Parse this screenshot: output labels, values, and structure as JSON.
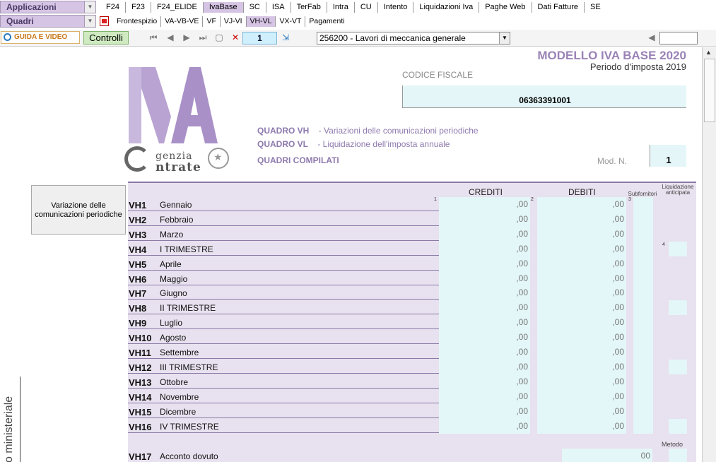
{
  "menu1": {
    "selector": "Applicazioni",
    "tabs": [
      "F24",
      "F23",
      "F24_ELIDE",
      "IvaBase",
      "SC",
      "ISA",
      "TerFab",
      "Intra",
      "CU",
      "Intento",
      "Liquidazioni Iva",
      "Paghe Web",
      "Dati Fatture",
      "SE"
    ],
    "active": 3
  },
  "menu2": {
    "selector": "Quadri",
    "tabs": [
      "Frontespizio",
      "VA-VB-VE",
      "VF",
      "VJ-VI",
      "VH-VL",
      "VX-VT",
      "Pagamenti"
    ],
    "active": 4
  },
  "toolbar": {
    "guide_label": "GUIDA E VIDEO",
    "controlli_label": "Controlli",
    "page_number": "1",
    "company": "256200 - Lavori di meccanica generale"
  },
  "doc": {
    "title": "MODELLO IVA BASE 2020",
    "subtitle": "Periodo d'imposta 2019",
    "cf_label": "CODICE FISCALE",
    "cf_value": "06363391001",
    "logo_letters": "IVA",
    "agency": "genzia\nntrate",
    "quadro1_key": "QUADRO VH",
    "quadro1_desc": "- Variazioni delle comunicazioni periodiche",
    "quadro2_key": "QUADRO VL",
    "quadro2_desc": "- Liquidazione dell'imposta annuale",
    "quadri_compilati": "QUADRI COMPILATI",
    "mod_n_label": "Mod. N.",
    "mod_n_value": "1",
    "side_button": "Variazione delle comunicazioni periodiche",
    "vertical_label": "ello ministeriale"
  },
  "grid": {
    "hdr_crediti": "CREDITI",
    "hdr_debiti": "DEBITI",
    "hdr_subfornitori": "Subfornitori",
    "hdr_liquidazione": "Liquidazione anticipata",
    "hdr_metodo": "Metodo",
    "col_nums": [
      "1",
      "2",
      "3",
      "4"
    ],
    "rows": [
      {
        "code": "VH1",
        "name": "Gennaio",
        "crediti": ",00",
        "debiti": ",00",
        "liq": false
      },
      {
        "code": "VH2",
        "name": "Febbraio",
        "crediti": ",00",
        "debiti": ",00",
        "liq": false
      },
      {
        "code": "VH3",
        "name": "Marzo",
        "crediti": ",00",
        "debiti": ",00",
        "liq": false
      },
      {
        "code": "VH4",
        "name": "I TRIMESTRE",
        "crediti": ",00",
        "debiti": ",00",
        "liq": true
      },
      {
        "code": "VH5",
        "name": "Aprile",
        "crediti": ",00",
        "debiti": ",00",
        "liq": false
      },
      {
        "code": "VH6",
        "name": "Maggio",
        "crediti": ",00",
        "debiti": ",00",
        "liq": false
      },
      {
        "code": "VH7",
        "name": "Giugno",
        "crediti": ",00",
        "debiti": ",00",
        "liq": false
      },
      {
        "code": "VH8",
        "name": "II TRIMESTRE",
        "crediti": ",00",
        "debiti": ",00",
        "liq": true
      },
      {
        "code": "VH9",
        "name": "Luglio",
        "crediti": ",00",
        "debiti": ",00",
        "liq": false
      },
      {
        "code": "VH10",
        "name": "Agosto",
        "crediti": ",00",
        "debiti": ",00",
        "liq": false
      },
      {
        "code": "VH11",
        "name": "Settembre",
        "crediti": ",00",
        "debiti": ",00",
        "liq": false
      },
      {
        "code": "VH12",
        "name": "III TRIMESTRE",
        "crediti": ",00",
        "debiti": ",00",
        "liq": true
      },
      {
        "code": "VH13",
        "name": "Ottobre",
        "crediti": ",00",
        "debiti": ",00",
        "liq": false
      },
      {
        "code": "VH14",
        "name": "Novembre",
        "crediti": ",00",
        "debiti": ",00",
        "liq": false
      },
      {
        "code": "VH15",
        "name": "Dicembre",
        "crediti": ",00",
        "debiti": ",00",
        "liq": false
      },
      {
        "code": "VH16",
        "name": "IV TRIMESTRE",
        "crediti": ",00",
        "debiti": ",00",
        "liq": true
      }
    ],
    "vh17": {
      "code": "VH17",
      "name": "Acconto dovuto",
      "value": "00"
    }
  },
  "colors": {
    "accent": "#d6c4e4",
    "grid_bg": "#e8e1ef",
    "input_bg": "#e3f6f8",
    "title": "#9a82b6"
  }
}
